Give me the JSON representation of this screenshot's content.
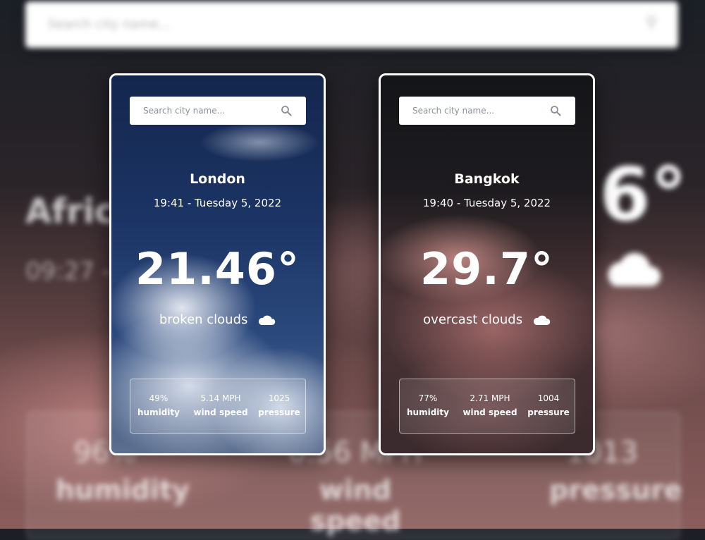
{
  "background": {
    "search_placeholder": "Search city name...",
    "city": "Africa",
    "date": "09:27 -",
    "temperature": "6°",
    "stats": [
      {
        "value": "96%",
        "label": "humidity"
      },
      {
        "value": "0.56 MPH",
        "label": "wind speed"
      },
      {
        "value": "1013",
        "label": "pressure"
      }
    ]
  },
  "cards": [
    {
      "search_placeholder": "Search city name...",
      "city": "London",
      "datetime": "19:41 - Tuesday 5, 2022",
      "temperature": "21.46°",
      "description": "broken clouds",
      "weather_icon": "cloud-icon",
      "humidity": {
        "value": "49%",
        "label": "humidity"
      },
      "wind": {
        "value": "5.14 MPH",
        "label": "wind speed"
      },
      "pressure": {
        "value": "1025",
        "label": "pressure"
      }
    },
    {
      "search_placeholder": "Search city name...",
      "city": "Bangkok",
      "datetime": "19:40 - Tuesday 5, 2022",
      "temperature": "29.7°",
      "description": "overcast clouds",
      "weather_icon": "cloud-icon",
      "humidity": {
        "value": "77%",
        "label": "humidity"
      },
      "wind": {
        "value": "2.71 MPH",
        "label": "wind speed"
      },
      "pressure": {
        "value": "1004",
        "label": "pressure"
      }
    }
  ],
  "colors": {
    "card_border": "#ffffff",
    "london_sky": "#1c3566",
    "bangkok_sky": "#4a3436",
    "text": "#ffffff"
  }
}
